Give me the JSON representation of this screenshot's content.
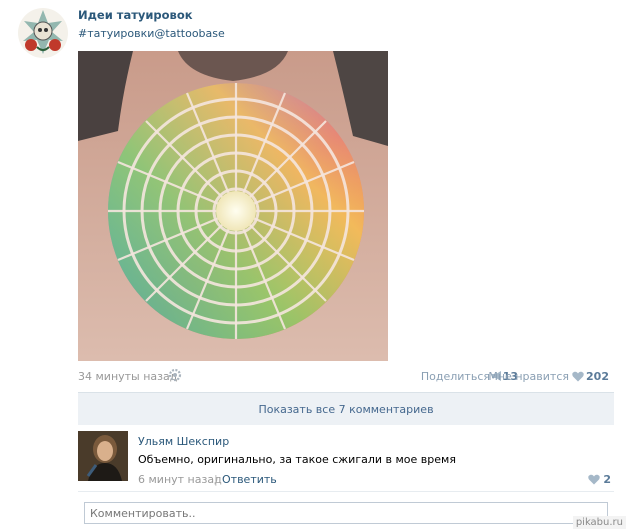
{
  "group": {
    "name": "Идеи татуировок",
    "tags": "#татуировки@tattoobase"
  },
  "post": {
    "time": "34 минуты назад",
    "share_label": "Поделиться",
    "share_count": "13",
    "like_label": "Мне нравится",
    "like_count": "202"
  },
  "comments": {
    "show_all_label": "Показать все 7 комментариев",
    "items": [
      {
        "author": "Ульям Шекспир",
        "text": "Объемно, оригинально, за такое сжигали в мое время",
        "time": "6 минут назад",
        "separator": "|",
        "reply_label": "Ответить",
        "likes": "2"
      }
    ],
    "input_placeholder": "Комментировать.."
  },
  "watermark": "pikabu.ru",
  "colors": {
    "link": "#2b587a",
    "muted": "#999999",
    "button_bg": "#edf1f5",
    "accent": "#5b7b99"
  },
  "icons": {
    "settings": "gear-icon",
    "share": "megaphone-icon",
    "like": "heart-icon"
  }
}
